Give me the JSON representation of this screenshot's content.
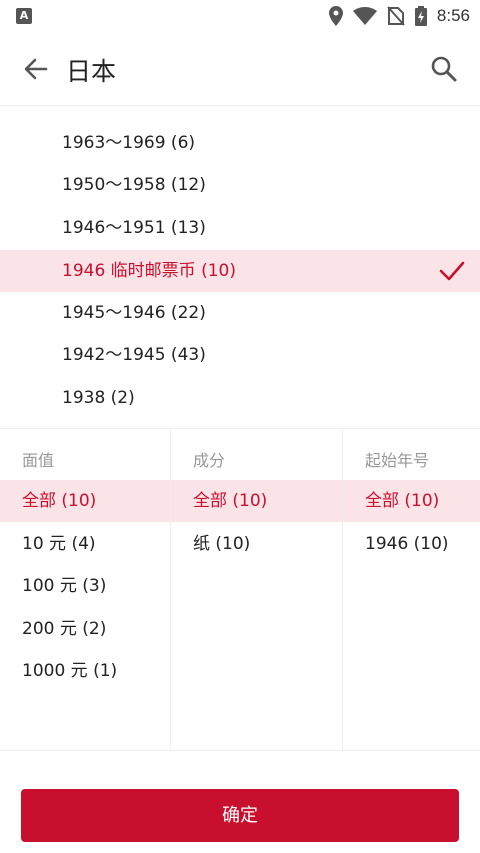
{
  "status_bar": {
    "time": "8:56",
    "left_icon": "A",
    "icons": [
      "location-icon",
      "wifi-icon",
      "no-sim-icon",
      "battery-charging-icon"
    ]
  },
  "app_bar": {
    "title": "日本",
    "back_icon": "arrow-left-icon",
    "search_icon": "search-icon"
  },
  "years": {
    "items": [
      {
        "label": "1963～1969 (6)"
      },
      {
        "label": "1950～1958 (12)"
      },
      {
        "label": "1946～1951 (13)"
      },
      {
        "label": "1946 临时邮票币 (10)",
        "selected": true
      },
      {
        "label": "1945～1946 (22)"
      },
      {
        "label": "1942～1945 (43)"
      },
      {
        "label": "1938 (2)"
      }
    ]
  },
  "filters": {
    "denomination": {
      "header": "面值",
      "options": [
        "全部 (10)",
        "10 元 (4)",
        "100 元 (3)",
        "200 元 (2)",
        "1000 元 (1)"
      ],
      "selected_index": 0
    },
    "composition": {
      "header": "成分",
      "options": [
        "全部 (10)",
        "纸 (10)"
      ],
      "selected_index": 0
    },
    "start_year": {
      "header": "起始年号",
      "options": [
        "全部 (10)",
        "1946 (10)"
      ],
      "selected_index": 0
    }
  },
  "confirm_label": "确定",
  "colors": {
    "accent": "#c8102e",
    "selected_bg": "#fbe4e8"
  }
}
